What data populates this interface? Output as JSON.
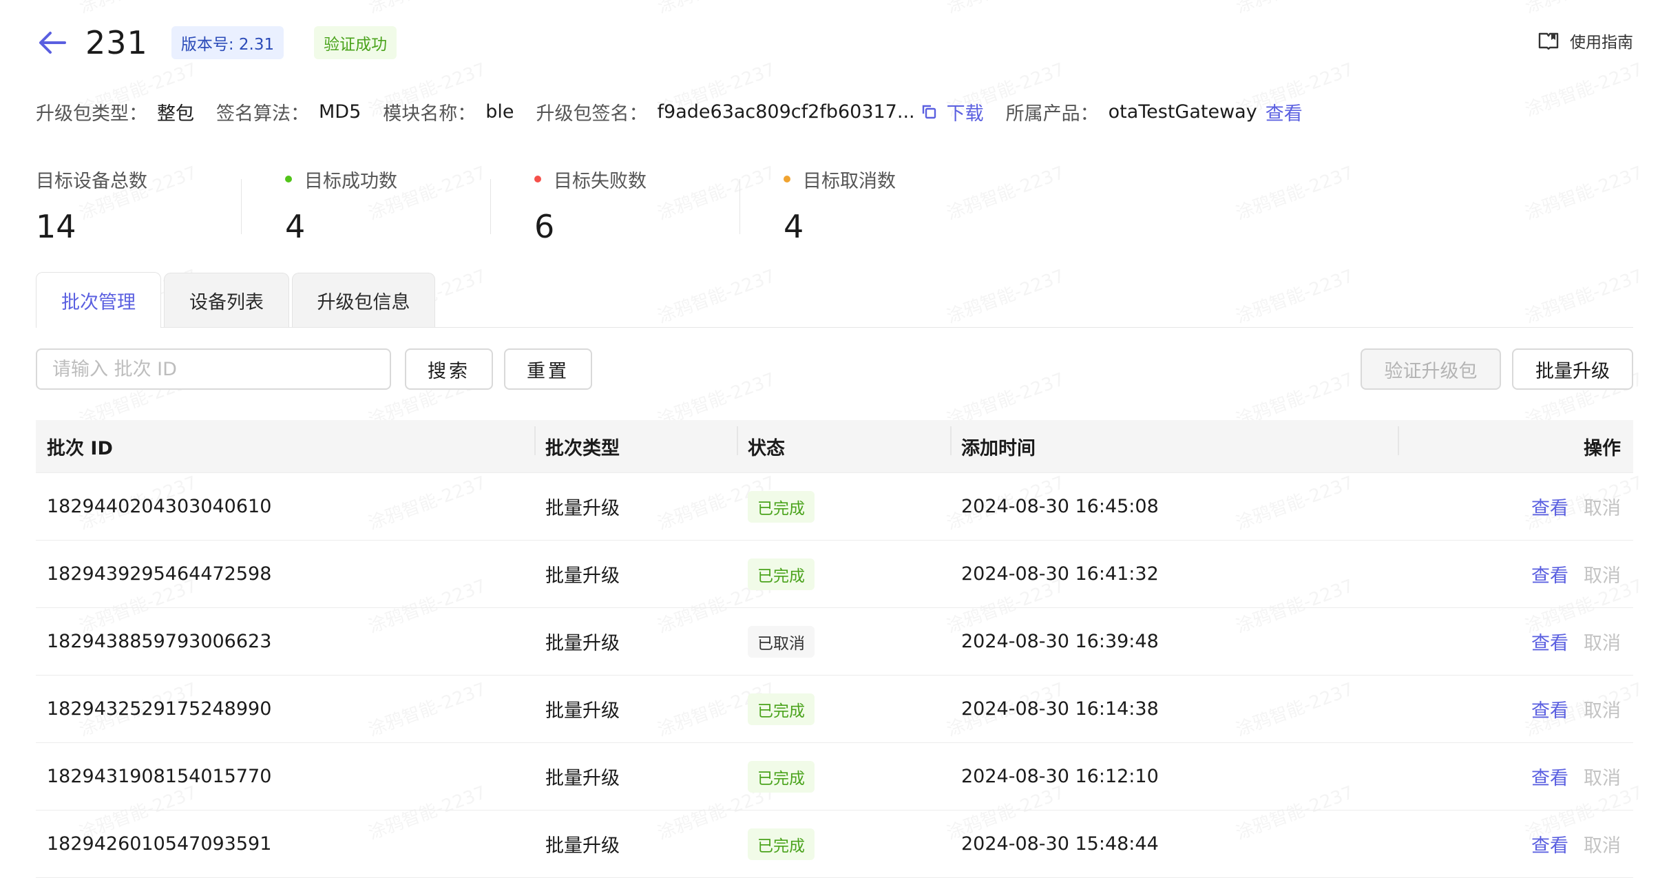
{
  "header": {
    "title": "231",
    "version": "版本号: 2.31",
    "verify_status": "验证成功",
    "guide_label": "使用指南"
  },
  "meta": {
    "pkg_type_label": "升级包类型：",
    "pkg_type_value": "整包",
    "sign_algo_label": "签名算法：",
    "sign_algo_value": "MD5",
    "module_label": "模块名称：",
    "module_value": "ble",
    "signature_label": "升级包签名：",
    "signature_value": "f9ade63ac809cf2fb60317...",
    "download_label": "下载",
    "product_label": "所属产品：",
    "product_value": "otaTestGateway",
    "view_label": "查看"
  },
  "stats": [
    {
      "label": "目标设备总数",
      "value": "14",
      "dot": ""
    },
    {
      "label": "目标成功数",
      "value": "4",
      "dot": "#52c41a"
    },
    {
      "label": "目标失败数",
      "value": "6",
      "dot": "#f5504a"
    },
    {
      "label": "目标取消数",
      "value": "4",
      "dot": "#f0a330"
    }
  ],
  "tabs": [
    {
      "label": "批次管理",
      "active": true
    },
    {
      "label": "设备列表",
      "active": false
    },
    {
      "label": "升级包信息",
      "active": false
    }
  ],
  "toolbar": {
    "search_placeholder": "请输入 批次 ID",
    "search_label": "搜索",
    "reset_label": "重置",
    "verify_pkg_label": "验证升级包",
    "batch_upgrade_label": "批量升级"
  },
  "table": {
    "headers": [
      "批次 ID",
      "批次类型",
      "状态",
      "添加时间",
      "操作"
    ],
    "rows": [
      {
        "id": "1829440204303040610",
        "type": "批量升级",
        "status": "已完成",
        "status_kind": "done",
        "time": "2024-08-30 16:45:08",
        "view": "查看",
        "cancel": "取消"
      },
      {
        "id": "1829439295464472598",
        "type": "批量升级",
        "status": "已完成",
        "status_kind": "done",
        "time": "2024-08-30 16:41:32",
        "view": "查看",
        "cancel": "取消"
      },
      {
        "id": "1829438859793006623",
        "type": "批量升级",
        "status": "已取消",
        "status_kind": "cancel",
        "time": "2024-08-30 16:39:48",
        "view": "查看",
        "cancel": "取消"
      },
      {
        "id": "1829432529175248990",
        "type": "批量升级",
        "status": "已完成",
        "status_kind": "done",
        "time": "2024-08-30 16:14:38",
        "view": "查看",
        "cancel": "取消"
      },
      {
        "id": "1829431908154015770",
        "type": "批量升级",
        "status": "已完成",
        "status_kind": "done",
        "time": "2024-08-30 16:12:10",
        "view": "查看",
        "cancel": "取消"
      },
      {
        "id": "1829426010547093591",
        "type": "批量升级",
        "status": "已完成",
        "status_kind": "done",
        "time": "2024-08-30 15:48:44",
        "view": "查看",
        "cancel": "取消"
      }
    ]
  },
  "colors": {
    "accent": "#5a5fe0",
    "success": "#4aa31c",
    "version_tag": "#2b4bb8"
  },
  "watermark": "涂鸦智能-2237"
}
